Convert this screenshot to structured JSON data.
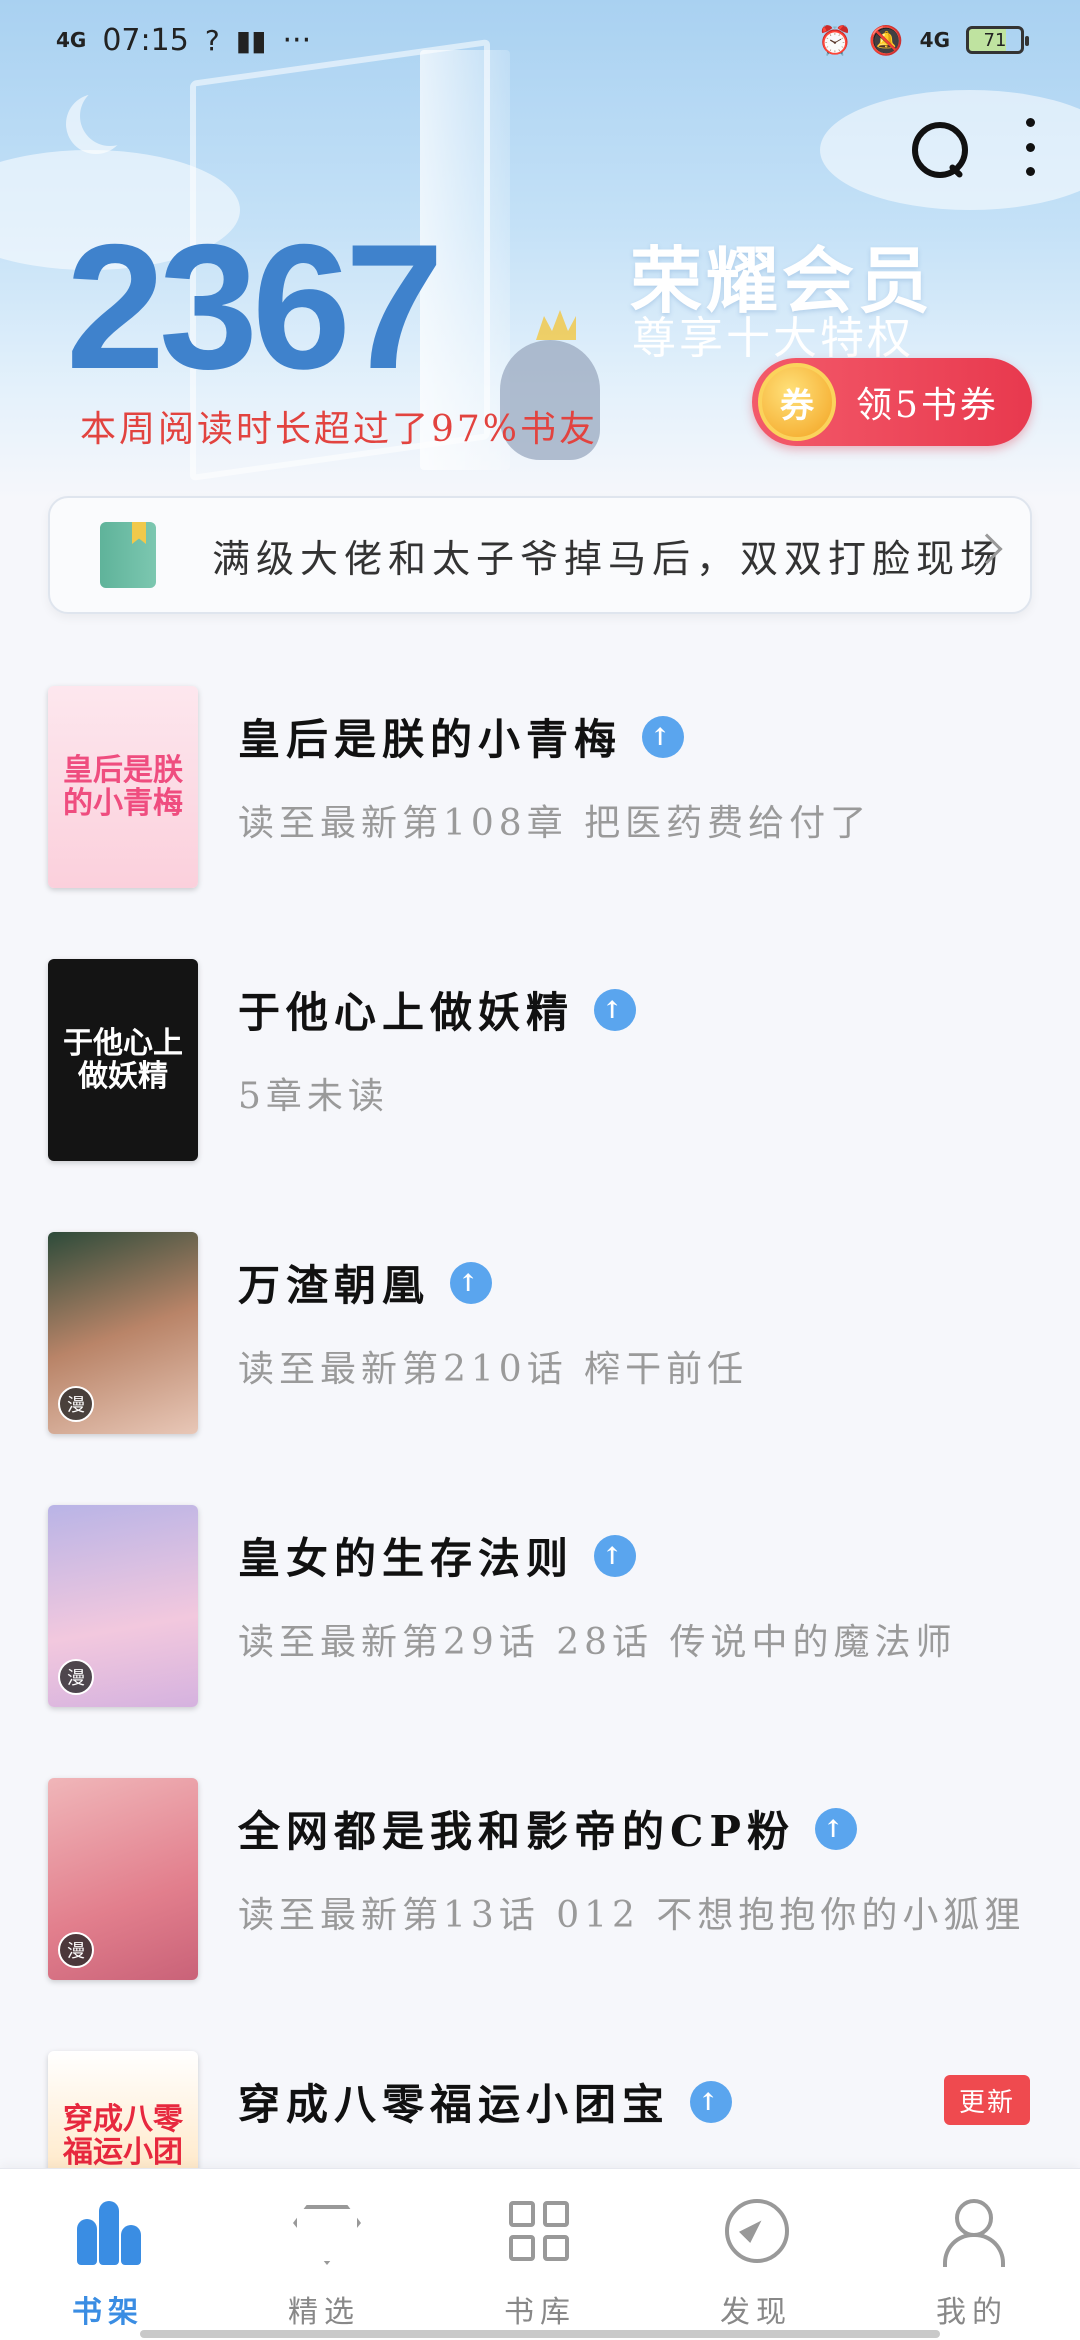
{
  "status_bar": {
    "network": "4G",
    "time": "07:15",
    "more": "···",
    "network_right": "4G",
    "battery": "71"
  },
  "header": {
    "reading_minutes": "2367",
    "reading_rank_text": "本周阅读时长超过了97%书友",
    "vip_title": "荣耀会员",
    "vip_subtitle": "尊享十大特权",
    "coupon_icon_text": "券",
    "coupon_label": "领5书券"
  },
  "recommendation": {
    "text": "满级大佬和太子爷掉马后，双双打脸现场"
  },
  "books": [
    {
      "title": "皇后是朕的小青梅",
      "progress": "读至最新第108章 把医药费给付了",
      "cover_text": "皇后是朕的小青梅",
      "comic": false,
      "update_badge": ""
    },
    {
      "title": "于他心上做妖精",
      "progress": "5章未读",
      "cover_text": "于他心上做妖精",
      "comic": false,
      "update_badge": ""
    },
    {
      "title": "万渣朝凰",
      "progress": "读至最新第210话 榨干前任",
      "cover_text": "",
      "comic": true,
      "update_badge": ""
    },
    {
      "title": "皇女的生存法则",
      "progress": "读至最新第29话 28话 传说中的魔法师",
      "cover_text": "",
      "comic": true,
      "update_badge": ""
    },
    {
      "title": "全网都是我和影帝的CP粉",
      "progress": "读至最新第13话 012 不想抱抱你的小狐狸",
      "cover_text": "",
      "comic": true,
      "update_badge": ""
    },
    {
      "title": "穿成八零福运小团宝",
      "progress": "",
      "cover_text": "穿成八零福运小团宝",
      "comic": false,
      "update_badge": "更新"
    }
  ],
  "comic_badge_text": "漫",
  "bottom_nav": [
    {
      "label": "书架",
      "icon": "bookshelf-icon",
      "active": true
    },
    {
      "label": "精选",
      "icon": "diamond-icon",
      "active": false
    },
    {
      "label": "书库",
      "icon": "grid-icon",
      "active": false
    },
    {
      "label": "发现",
      "icon": "compass-icon",
      "active": false
    },
    {
      "label": "我的",
      "icon": "profile-icon",
      "active": false
    }
  ],
  "colors": {
    "accent": "#3a8de3",
    "reading_time": "#3f82cc",
    "alert": "#ef4a4f"
  }
}
